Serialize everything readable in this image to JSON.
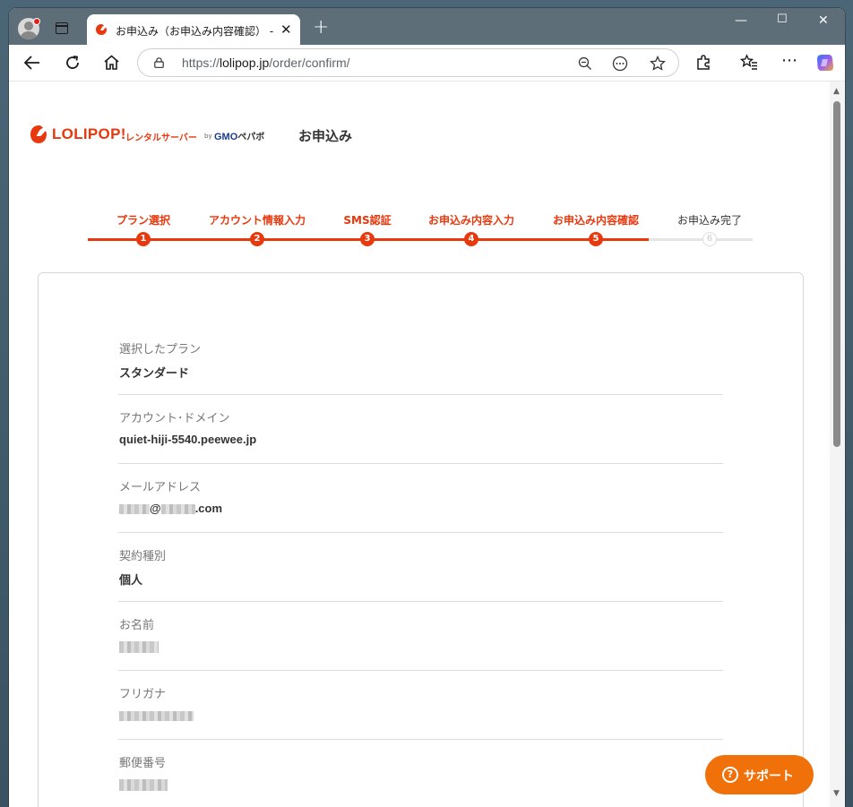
{
  "browser": {
    "tab_title": "お申込み（お申込み内容確認） - Ď",
    "tab_close": "✕",
    "new_tab": "+",
    "url_prefix": "https://",
    "url_host": "lolipop.jp",
    "url_path": "/order/confirm/",
    "window_controls": {
      "minimize": "—",
      "maximize": "☐",
      "close": "✕"
    }
  },
  "header": {
    "brand_name": "LOLIPOP!",
    "brand_sub": "レンタルサーバー",
    "brand_by": "by",
    "brand_gmo": "GMO",
    "brand_pepabo": "ペパボ",
    "page_title": "お申込み"
  },
  "stepper": {
    "steps": [
      {
        "label": "プラン選択",
        "number": "1",
        "state": "done"
      },
      {
        "label": "アカウント情報入力",
        "number": "2",
        "state": "done"
      },
      {
        "label": "SMS認証",
        "number": "3",
        "state": "done"
      },
      {
        "label": "お申込み内容入力",
        "number": "4",
        "state": "done"
      },
      {
        "label": "お申込み内容確認",
        "number": "5",
        "state": "current"
      },
      {
        "label": "お申込み完了",
        "number": "6",
        "state": "pending"
      }
    ],
    "progress_fraction": 0.84
  },
  "confirm": {
    "plan_label": "選択したプラン",
    "plan_value": "スタンダード",
    "domain_label": "アカウント･ドメイン",
    "domain_value": "quiet-hiji-5540.peewee.jp",
    "email_label": "メールアドレス",
    "email_at": "@",
    "email_suffix": ".com",
    "contract_label": "契約種別",
    "contract_value": "個人",
    "name_label": "お名前",
    "kana_label": "フリガナ",
    "zip_label": "郵便番号"
  },
  "support": {
    "icon": "?",
    "label": "サポート"
  },
  "colors": {
    "accent": "#e8380d",
    "support": "#f0700a",
    "tabstrip": "#5d6e78"
  }
}
